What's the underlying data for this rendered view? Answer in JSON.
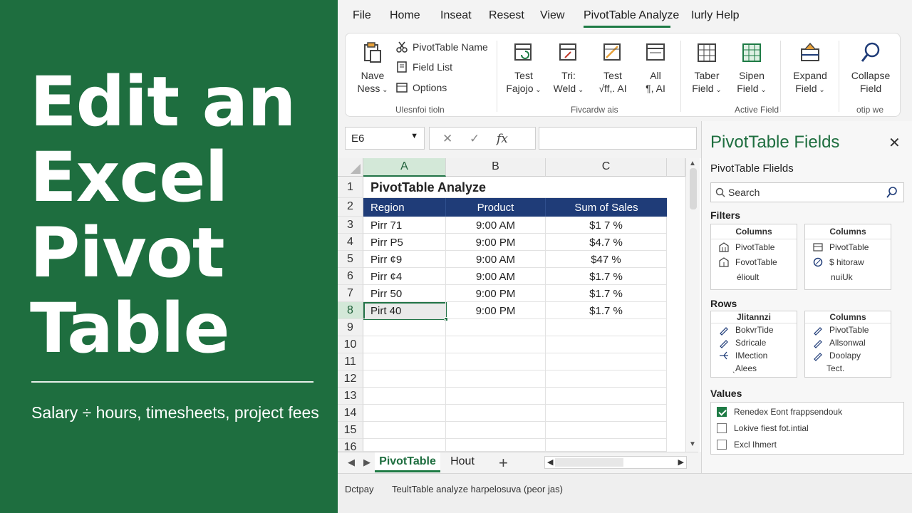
{
  "promo": {
    "title_lines": [
      "Edit an",
      "Excel",
      "Pivot",
      "Table"
    ],
    "subtitle": "Salary ÷ hours, timesheets, project fees"
  },
  "menu": {
    "items": [
      "File",
      "Home",
      "Inseat",
      "Resest",
      "View",
      "PivotTable Analyze",
      "Ιurly Help"
    ],
    "active": "PivotTable Analyze"
  },
  "ribbon": {
    "nave_ness": "Nave\nNess",
    "pivottable_name": "PivotTable Name",
    "field_list": "Field List",
    "options": "Options",
    "group1_label": "Ulesnfoi tioln",
    "test_fajojo": "Test\nFajojo",
    "tri_weld": "Tri:\nWeld",
    "test_ai": "Test\n√ff,. AI",
    "all_ai": "All\n¶, AI",
    "group2_label": "Fivcardw ais",
    "taber_field": "Taber\nField",
    "sipen_field": "Sipen\nField",
    "expand_field": "Expand\nField",
    "group3_label": "Active Field",
    "collapse_field": "Collapse\nField",
    "group4_label": "otip we"
  },
  "formula_bar": {
    "name_box": "E6",
    "cancel": "✕",
    "enter": "✓",
    "fx": "fx",
    "value": ""
  },
  "grid": {
    "columns": [
      "A",
      "B",
      "C"
    ],
    "selected_column": "A",
    "row_numbers": [
      "1",
      "2",
      "3",
      "4",
      "5",
      "6",
      "7",
      "8",
      "9",
      "10",
      "11",
      "12",
      "13",
      "14",
      "15",
      "16"
    ],
    "selected_row": "8",
    "title": "PivotTable Analyze",
    "headers": [
      "Region",
      "Product",
      "Sum of Sales"
    ],
    "rows": [
      [
        "Pirr 71",
        "9:00 AM",
        "$1 7 %"
      ],
      [
        "Pirr P5",
        "9:00 PM",
        "$4.7 %"
      ],
      [
        "Pirr ¢9",
        "9:00 AM",
        "$47 %"
      ],
      [
        "Pirr ¢4",
        "9:00 AM",
        "$1.7 %"
      ],
      [
        "Pirr 50",
        "9:00 PM",
        "$1.7 %"
      ],
      [
        "Pirt 40",
        "9:00 PM",
        "$1.7 %"
      ]
    ]
  },
  "sheet_tabs": {
    "tabs": [
      "PivotTable",
      "Hout"
    ],
    "active": "PivotTable",
    "add": "+"
  },
  "status": {
    "left": "Dctpay",
    "message": "TeultTable analyze harpelosuva (peor jas)"
  },
  "fields_pane": {
    "title": "PivotTable Fields",
    "subtitle": "PivotTable Flields",
    "search_placeholder": "Search",
    "filters_label": "Filters",
    "filters_boxes": [
      {
        "header": "Columns",
        "items": [
          {
            "icon": "pivot-icon",
            "label": "PivotTable"
          },
          {
            "icon": "pivot-icon",
            "label": "FovotTable"
          },
          {
            "icon": "",
            "label": "élioult"
          }
        ]
      },
      {
        "header": "Columns",
        "items": [
          {
            "icon": "pivot-icon",
            "label": "PivotTable"
          },
          {
            "icon": "circle-icon",
            "label": "$ hitoraw"
          },
          {
            "icon": "",
            "label": "nuiUk"
          }
        ]
      }
    ],
    "rows_label": "Rows",
    "rows_boxes": [
      {
        "header": "Jlitannzi",
        "items": [
          {
            "icon": "pen-icon",
            "label": "BokvrTide"
          },
          {
            "icon": "pen-icon",
            "label": "Sdricale"
          },
          {
            "icon": "branch-icon",
            "label": "IMection"
          },
          {
            "icon": "",
            "label": "ˎAlees"
          }
        ]
      },
      {
        "header": "Columns",
        "items": [
          {
            "icon": "pen-icon",
            "label": "PivotTable"
          },
          {
            "icon": "pen-icon",
            "label": "Allsonwal"
          },
          {
            "icon": "pen-icon",
            "label": "Doolapy"
          },
          {
            "icon": "",
            "label": "Tect."
          }
        ]
      }
    ],
    "values_label": "Values",
    "values": [
      {
        "label": "Renedex Eont frappsendouk",
        "checked": true
      },
      {
        "label": "Lokive fiest fot.intial",
        "checked": false
      },
      {
        "label": "Excl Ihmert",
        "checked": false
      }
    ]
  },
  "colors": {
    "promo_green": "#1e6e3f",
    "accent": "#1e7b45",
    "header_navy": "#1f3c78"
  }
}
